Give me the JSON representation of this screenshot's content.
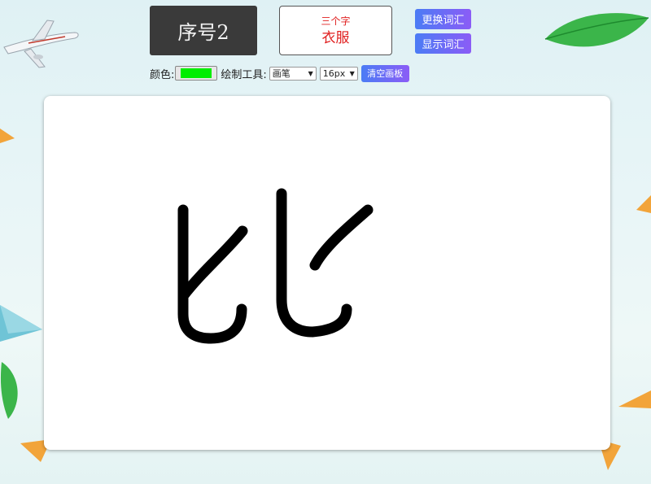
{
  "header": {
    "serial_label": "序号2",
    "hint_count": "三个字",
    "hint_word": "衣服"
  },
  "buttons": {
    "change_words": "更换词汇",
    "show_words": "显示词汇",
    "clear_canvas": "清空画板"
  },
  "toolbar": {
    "color_label": "颜色:",
    "color_value": "#00ee00",
    "tool_label": "绘制工具:",
    "tool_selected": "画笔",
    "size_selected": "16px"
  },
  "canvas": {
    "stroke_color": "#000000",
    "background": "#ffffff"
  },
  "colors": {
    "button_gradient_start": "#4b7cf5",
    "button_gradient_end": "#8b5cf6",
    "hint_text": "#e02020",
    "serial_bg": "#3a3a3a"
  }
}
